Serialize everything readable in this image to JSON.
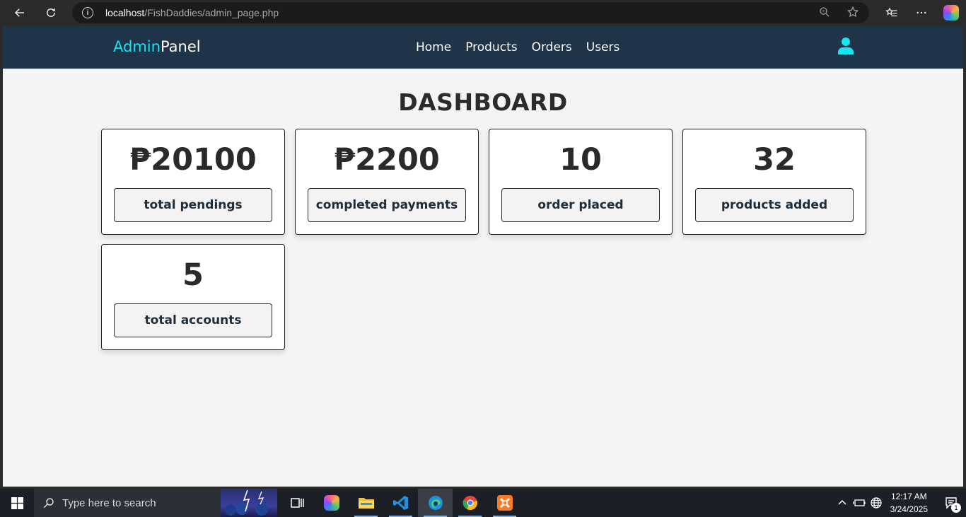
{
  "browser": {
    "url_host": "localhost",
    "url_path": "/FishDaddies/admin_page.php"
  },
  "header": {
    "logo_accent": "Admin",
    "logo_rest": "Panel",
    "nav": [
      "Home",
      "Products",
      "Orders",
      "Users"
    ]
  },
  "dashboard": {
    "title": "DASHBOARD",
    "cards": [
      {
        "value": "₱20100",
        "label": "total pendings"
      },
      {
        "value": "₱2200",
        "label": "completed payments"
      },
      {
        "value": "10",
        "label": "order placed"
      },
      {
        "value": "32",
        "label": "products added"
      },
      {
        "value": "5",
        "label": "total accounts"
      }
    ]
  },
  "taskbar": {
    "search_placeholder": "Type here to search",
    "time": "12:17 AM",
    "date": "3/24/2025",
    "notification_count": "1"
  },
  "colors": {
    "header_bg": "#1f3349",
    "accent": "#16e4f0",
    "page_bg": "#f4f4f4"
  }
}
